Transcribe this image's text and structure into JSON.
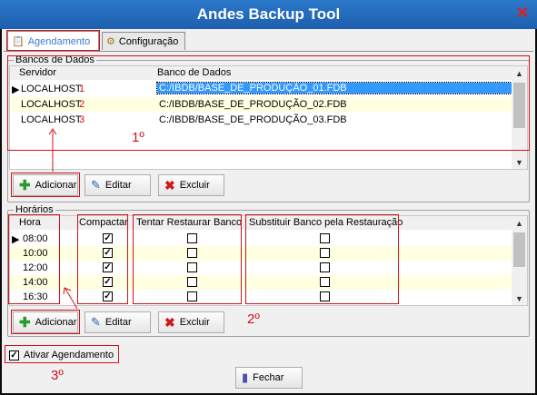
{
  "window": {
    "title": "Andes Backup Tool"
  },
  "tabs": [
    {
      "label": "Agendamento",
      "active": true
    },
    {
      "label": "Configuração",
      "active": false
    }
  ],
  "bancos": {
    "group_label": "Bancos de Dados",
    "columns": [
      "Servidor",
      "Banco de Dados"
    ],
    "rows": [
      {
        "servidor": "LOCALHOST",
        "num": "1",
        "banco": "C:/IBDB/BASE_DE_PRODUÇÃO_01.FDB",
        "selected": true
      },
      {
        "servidor": "LOCALHOST",
        "num": "2",
        "banco": "C:/IBDB/BASE_DE_PRODUÇÃO_02.FDB",
        "selected": false
      },
      {
        "servidor": "LOCALHOST",
        "num": "3",
        "banco": "C:/IBDB/BASE_DE_PRODUÇÃO_03.FDB",
        "selected": false
      }
    ],
    "annotation": "1º",
    "buttons": {
      "adicionar": "Adicionar",
      "editar": "Editar",
      "excluir": "Excluir"
    }
  },
  "horarios": {
    "group_label": "Horários",
    "columns": [
      "Hora",
      "Compactar",
      "Tentar Restaurar Banco",
      "Substituir Banco pela Restauração"
    ],
    "rows": [
      {
        "hora": "08:00",
        "compactar": true,
        "restaurar": false,
        "substituir": false
      },
      {
        "hora": "10:00",
        "compactar": true,
        "restaurar": false,
        "substituir": false
      },
      {
        "hora": "12:00",
        "compactar": true,
        "restaurar": false,
        "substituir": false
      },
      {
        "hora": "14:00",
        "compactar": true,
        "restaurar": false,
        "substituir": false
      },
      {
        "hora": "16:30",
        "compactar": true,
        "restaurar": false,
        "substituir": false
      }
    ],
    "annotation": "2º",
    "buttons": {
      "adicionar": "Adicionar",
      "editar": "Editar",
      "excluir": "Excluir"
    }
  },
  "ativar": {
    "label": "Ativar Agendamento",
    "checked": true,
    "annotation": "3º"
  },
  "fechar_label": "Fechar",
  "colors": {
    "titlebar": "#1d5fae",
    "annotation_red": "#d0121b",
    "selection": "#3399ff",
    "row_yellow": "#ffffe1"
  }
}
